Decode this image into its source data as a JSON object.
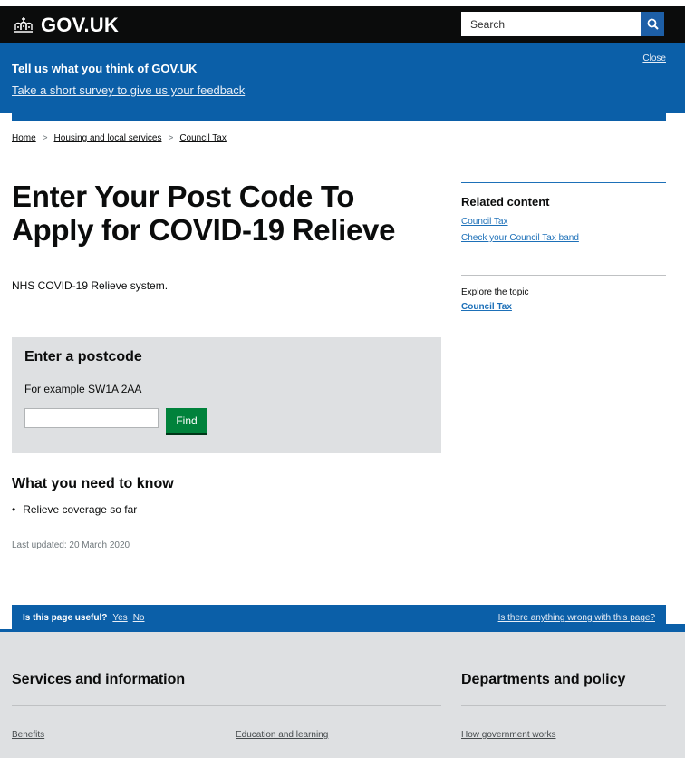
{
  "header": {
    "logo_text": "GOV.UK",
    "logo_icon": "crown-icon",
    "search_placeholder": "Search",
    "search_icon": "search-icon"
  },
  "survey": {
    "title": "Tell us what you think of GOV.UK",
    "link": "Take a short survey to give us your feedback",
    "close": "Close"
  },
  "breadcrumb": [
    {
      "label": "Home"
    },
    {
      "label": "Housing and local services"
    },
    {
      "label": "Council Tax"
    }
  ],
  "main": {
    "title": "Enter Your Post Code To Apply for COVID-19 Relieve",
    "lede": "NHS COVID-19 Relieve system.",
    "postcode": {
      "heading": "Enter a postcode",
      "hint": "For example SW1A 2AA",
      "input_value": "",
      "button": "Find"
    },
    "know": {
      "heading": "What you need to know",
      "items": [
        "Relieve coverage so far"
      ]
    },
    "last_updated": "Last updated: 20 March 2020"
  },
  "sidebar": {
    "related_title": "Related content",
    "related_links": [
      "Council Tax",
      "Check your Council Tax band"
    ],
    "explore_label": "Explore the topic",
    "explore_link": "Council Tax"
  },
  "feedback": {
    "question": "Is this page useful?",
    "yes": "Yes",
    "no": "No",
    "wrong": "Is there anything wrong with this page?"
  },
  "footer": {
    "services_heading": "Services and information",
    "departments_heading": "Departments and policy",
    "links": [
      "Benefits",
      "Education and learning",
      "How government works"
    ]
  },
  "colors": {
    "header_bg": "#0b0c0c",
    "brand_blue": "#0b5fa8",
    "link_blue": "#1d70b8",
    "button_green": "#00823b",
    "panel_grey": "#dee0e2"
  }
}
